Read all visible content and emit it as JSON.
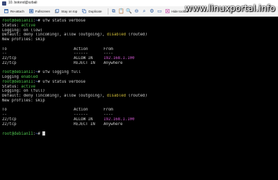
{
  "window": {
    "title": "10. botond@szbali"
  },
  "watermark": "www.linuxportal.info",
  "toolbar": {
    "buttons": [
      {
        "label": "Re-attach",
        "icon": "reattach-icon"
      },
      {
        "label": "Fullscreen",
        "icon": "fullscreen-icon"
      },
      {
        "label": "Stay on top",
        "icon": "stay-on-top-icon"
      },
      {
        "label": "Duplicate",
        "icon": "duplicate-icon"
      }
    ],
    "hide_label": "Hide toolbar"
  },
  "terminal": {
    "prompt_user": "root@debian11",
    "prompt_sep": ":",
    "prompt_path": "~",
    "prompt_symbol": "# ",
    "blocks": [
      {
        "command": "ufw status verbose",
        "status_label": "Status: ",
        "status_value": "active",
        "logging": "Logging: on (low)",
        "default_prefix": "Default: deny (incoming), allow (outgoing), ",
        "default_disabled": "disabled",
        "default_suffix": " (routed)",
        "new_profiles": "New profiles: skip",
        "headers": [
          "To",
          "Action",
          "From"
        ],
        "dashes": [
          "--",
          "------",
          "----"
        ],
        "rows": [
          [
            "22/tcp",
            "ALLOW IN",
            "192.168.1.100"
          ],
          [
            "22/tcp",
            "REJECT IN",
            "Anywhere"
          ]
        ]
      },
      {
        "command": "ufw logging full",
        "output_prefix": "Logging ",
        "output_value": "enabled"
      },
      {
        "command": "ufw status verbose",
        "status_label": "Status: ",
        "status_value": "active",
        "logging": "Logging: on (full)",
        "default_prefix": "Default: deny (incoming), allow (outgoing), ",
        "default_disabled": "disabled",
        "default_suffix": " (routed)",
        "new_profiles": "New profiles: skip",
        "headers": [
          "To",
          "Action",
          "From"
        ],
        "dashes": [
          "--",
          "------",
          "----"
        ],
        "rows": [
          [
            "22/tcp",
            "ALLOW IN",
            "192.168.1.100"
          ],
          [
            "22/tcp",
            "REJECT IN",
            "Anywhere"
          ]
        ]
      }
    ]
  }
}
